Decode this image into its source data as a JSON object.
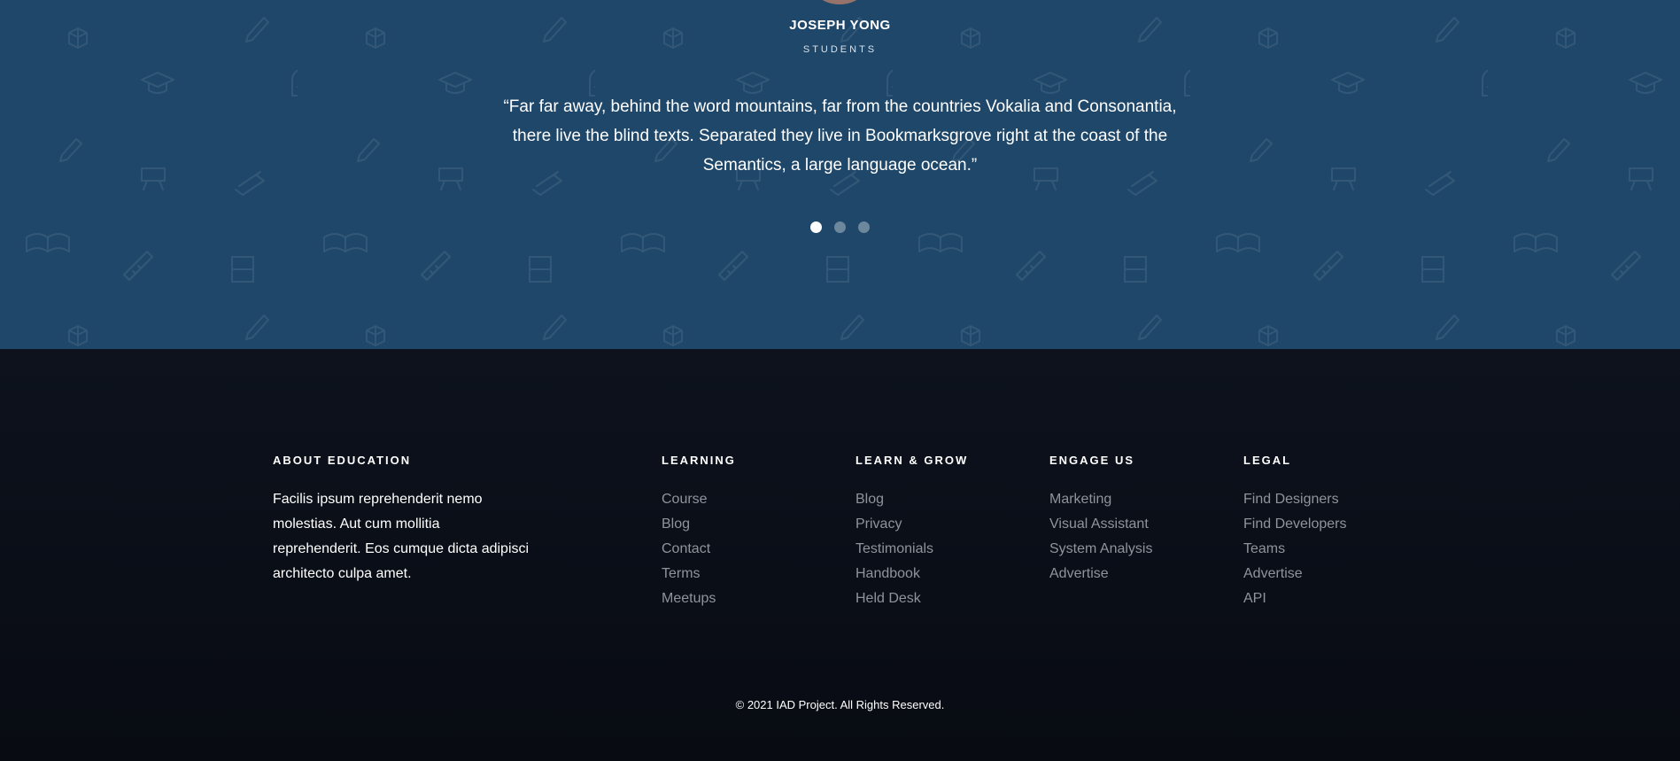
{
  "testimonial": {
    "name": "JOSEPH YONG",
    "role": "STUDENTS",
    "quote_lines": [
      "“Far far away, behind the word mountains, far from the countries Vokalia and Consonantia,",
      "there live the blind texts. Separated they live in Bookmarksgrove right at the coast of the",
      "Semantics, a large language ocean.”"
    ],
    "active_slide": 1,
    "slide_count": 3
  },
  "footer": {
    "about": {
      "title": "ABOUT EDUCATION",
      "text_lines": [
        "Facilis ipsum reprehenderit nemo",
        "molestias. Aut cum mollitia",
        "reprehenderit. Eos cumque dicta adipisci",
        "architecto culpa amet."
      ]
    },
    "columns": [
      {
        "title": "LEARNING",
        "links": [
          "Course",
          "Blog",
          "Contact",
          "Terms",
          "Meetups"
        ]
      },
      {
        "title": "LEARN & GROW",
        "links": [
          "Blog",
          "Privacy",
          "Testimonials",
          "Handbook",
          "Held Desk"
        ]
      },
      {
        "title": "ENGAGE US",
        "links": [
          "Marketing",
          "Visual Assistant",
          "System Analysis",
          "Advertise"
        ]
      },
      {
        "title": "LEGAL",
        "links": [
          "Find Designers",
          "Find Developers",
          "Teams",
          "Advertise",
          "API"
        ]
      }
    ],
    "copyright": "© 2021 IAD Project. All Rights Reserved."
  },
  "colors": {
    "testimonial_bg": "#1f4769",
    "footer_bg": "#0b0f19",
    "link": "#8f949c",
    "heading": "#ffffff"
  }
}
